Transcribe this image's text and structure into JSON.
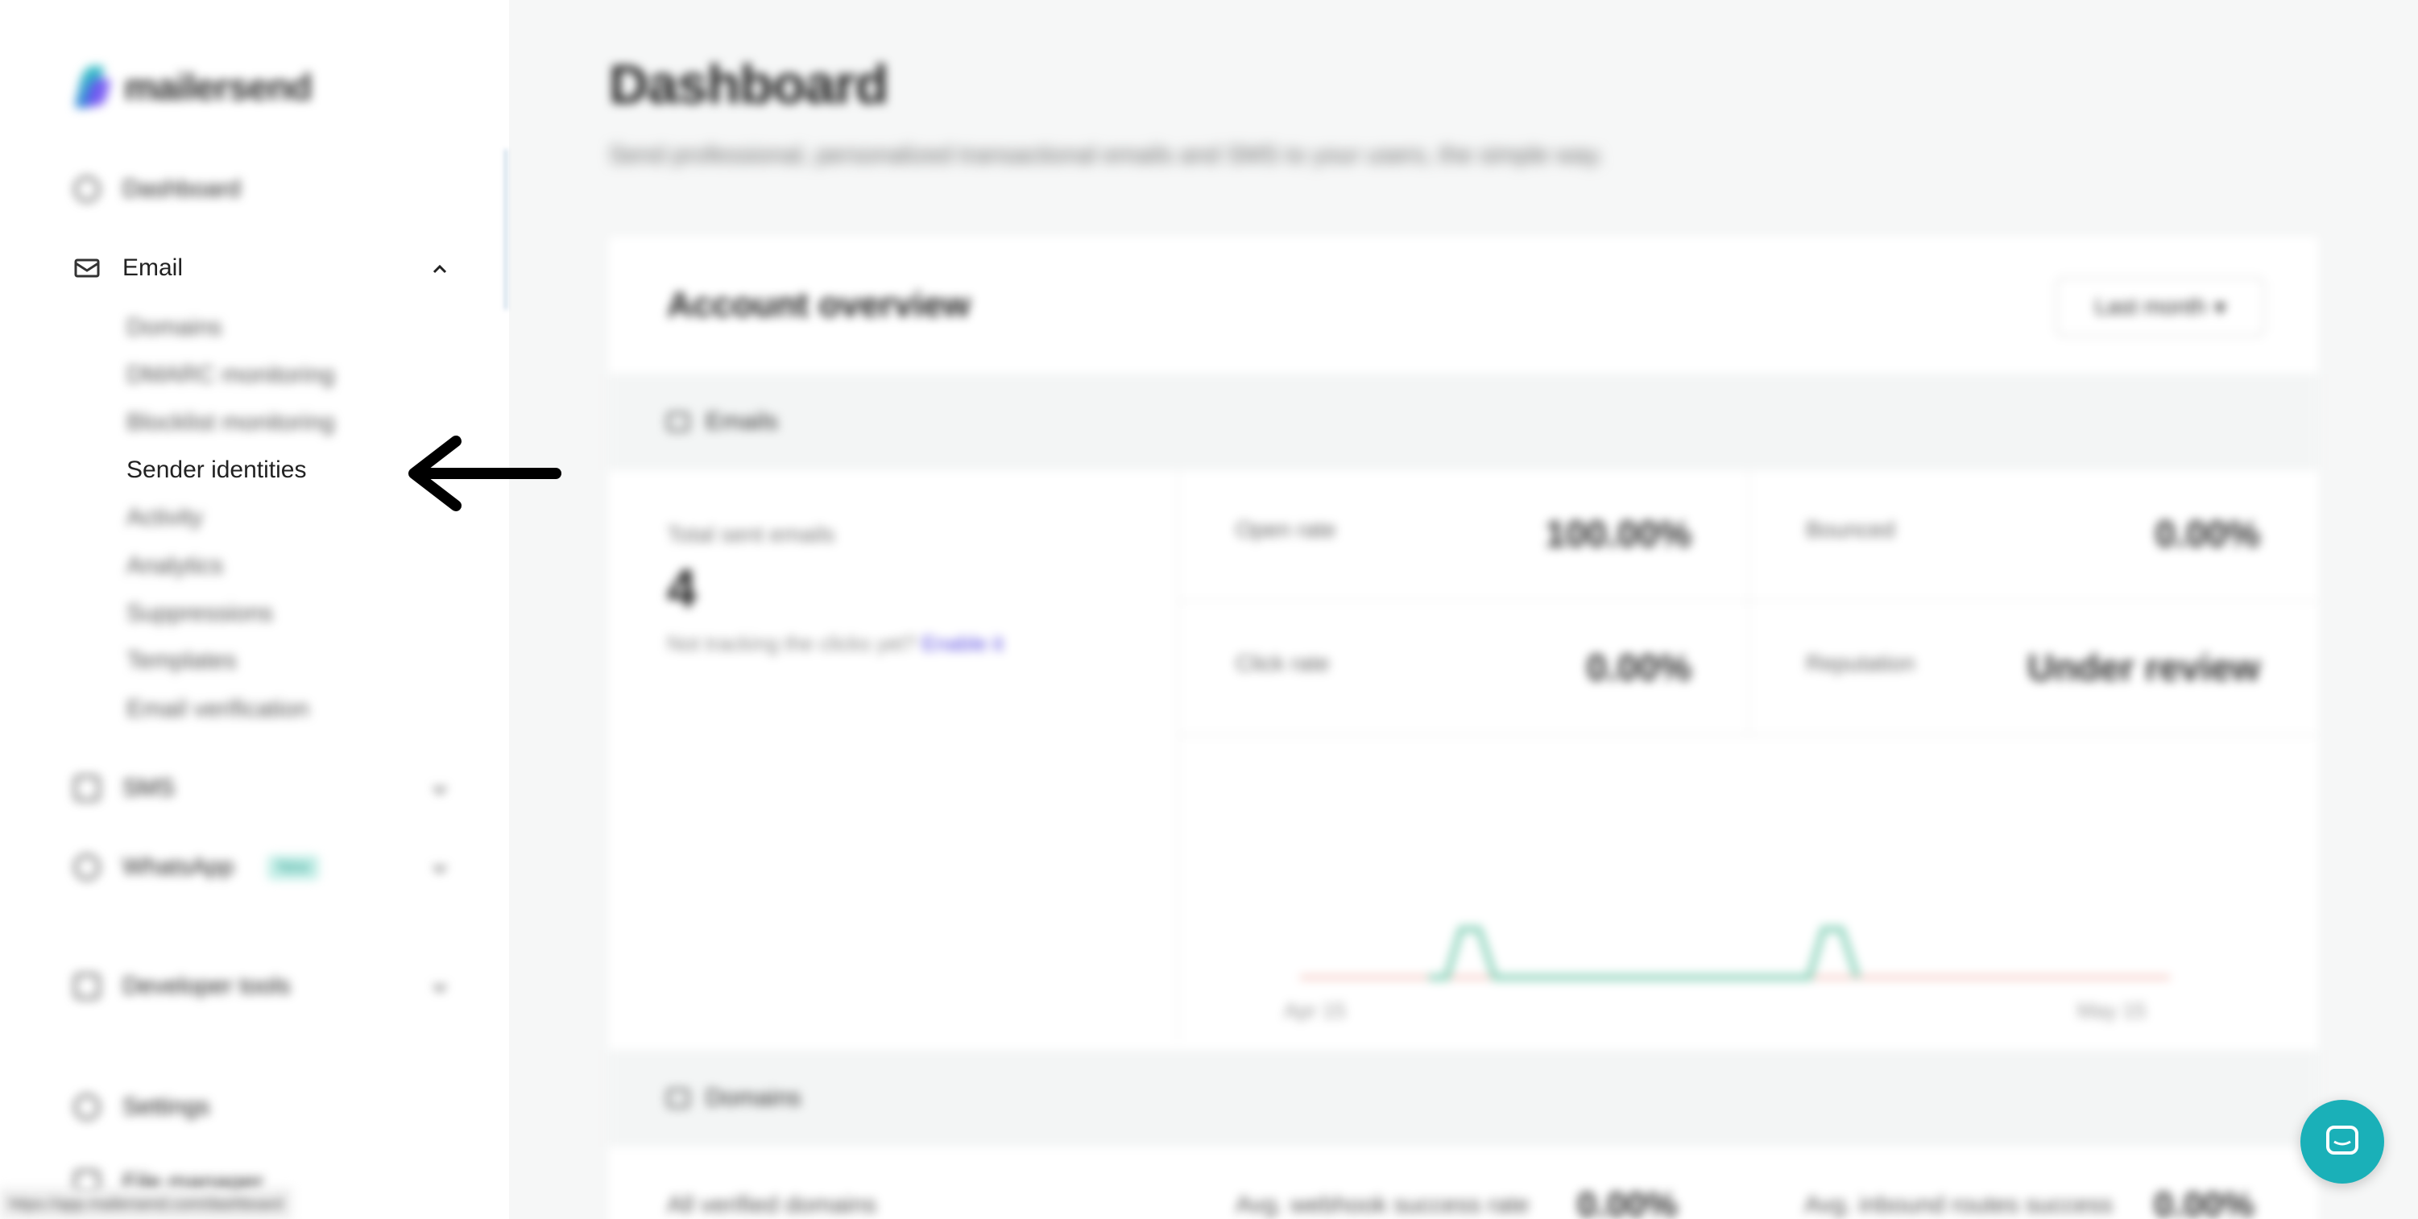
{
  "sidebar": {
    "logo_text": "mailersend",
    "dashboard": "Dashboard",
    "email": "Email",
    "email_sub": [
      "Domains",
      "DMARC monitoring",
      "Blocklist monitoring",
      "Sender identities",
      "Activity",
      "Analytics",
      "Suppressions",
      "Templates",
      "Email verification"
    ],
    "sms": "SMS",
    "whatsapp": "WhatsApp",
    "whatsapp_badge": "New",
    "developer_tools": "Developer tools",
    "settings": "Settings",
    "file_manager": "File manager"
  },
  "status_url": "https://app.mailersend.com/dashboard",
  "main": {
    "title": "Dashboard",
    "subtitle": "Send professional, personalized transactional emails and SMS to your users, the simple way.",
    "overview_title": "Account overview",
    "range": "Last month",
    "emails_section": "Emails",
    "total_sent_label": "Total sent emails",
    "total_sent_value": "4",
    "tracking_text": "Not tracking the clicks yet?",
    "tracking_link": "Enable it",
    "metrics": [
      {
        "label": "Open rate",
        "value": "100.00%"
      },
      {
        "label": "Bounced",
        "value": "0.00%"
      },
      {
        "label": "Click rate",
        "value": "0.00%"
      },
      {
        "label": "Reputation",
        "value": "Under review"
      }
    ],
    "chart_x_start": "Apr 15",
    "chart_x_end": "May 15",
    "domains_section": "Domains",
    "domains_row": [
      {
        "label": "All verified domains",
        "value": ""
      },
      {
        "label": "Avg. webhook success rate",
        "value": "0.00%"
      },
      {
        "label": "Avg. inbound routes success",
        "value": "0.00%"
      }
    ]
  },
  "colors": {
    "accent": "#1ab0b8",
    "link": "#5a4ce0",
    "spark": "#8fd4bd",
    "baseline": "#f2b8b0"
  }
}
